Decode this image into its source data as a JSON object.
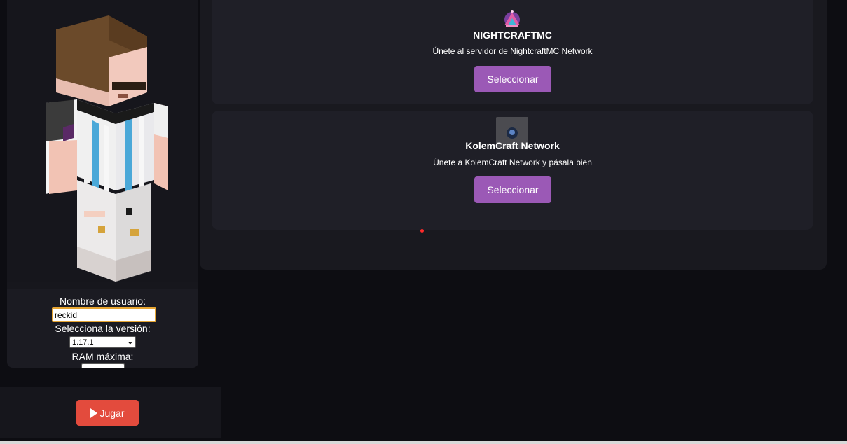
{
  "sidebar": {
    "username_label": "Nombre de usuario:",
    "username_value": "reckid",
    "version_label": "Selecciona la versión:",
    "version_selected": "1.17.1",
    "ram_label": "RAM máxima:"
  },
  "launch": {
    "play_label": "Jugar"
  },
  "servers": [
    {
      "name": "NIGHTCRAFTMC",
      "description": "Únete al servidor de NightcraftMC Network",
      "button_label": "Seleccionar"
    },
    {
      "name": "KolemCraft Network",
      "description": "Únete a KolemCraft Network y pásala bien",
      "button_label": "Seleccionar"
    }
  ],
  "colors": {
    "background": "#0d0d12",
    "panel": "#19191f",
    "card": "#1f1f27",
    "select_button": "#9b59b6",
    "play_button": "#e34b3d",
    "input_focus": "#e6a532"
  },
  "icons": {
    "play": "play-icon",
    "nightcraft_logo": "nightcraft-logo-icon",
    "kolemcraft_logo": "kolemcraft-logo-icon",
    "skin": "minecraft-skin-preview"
  }
}
